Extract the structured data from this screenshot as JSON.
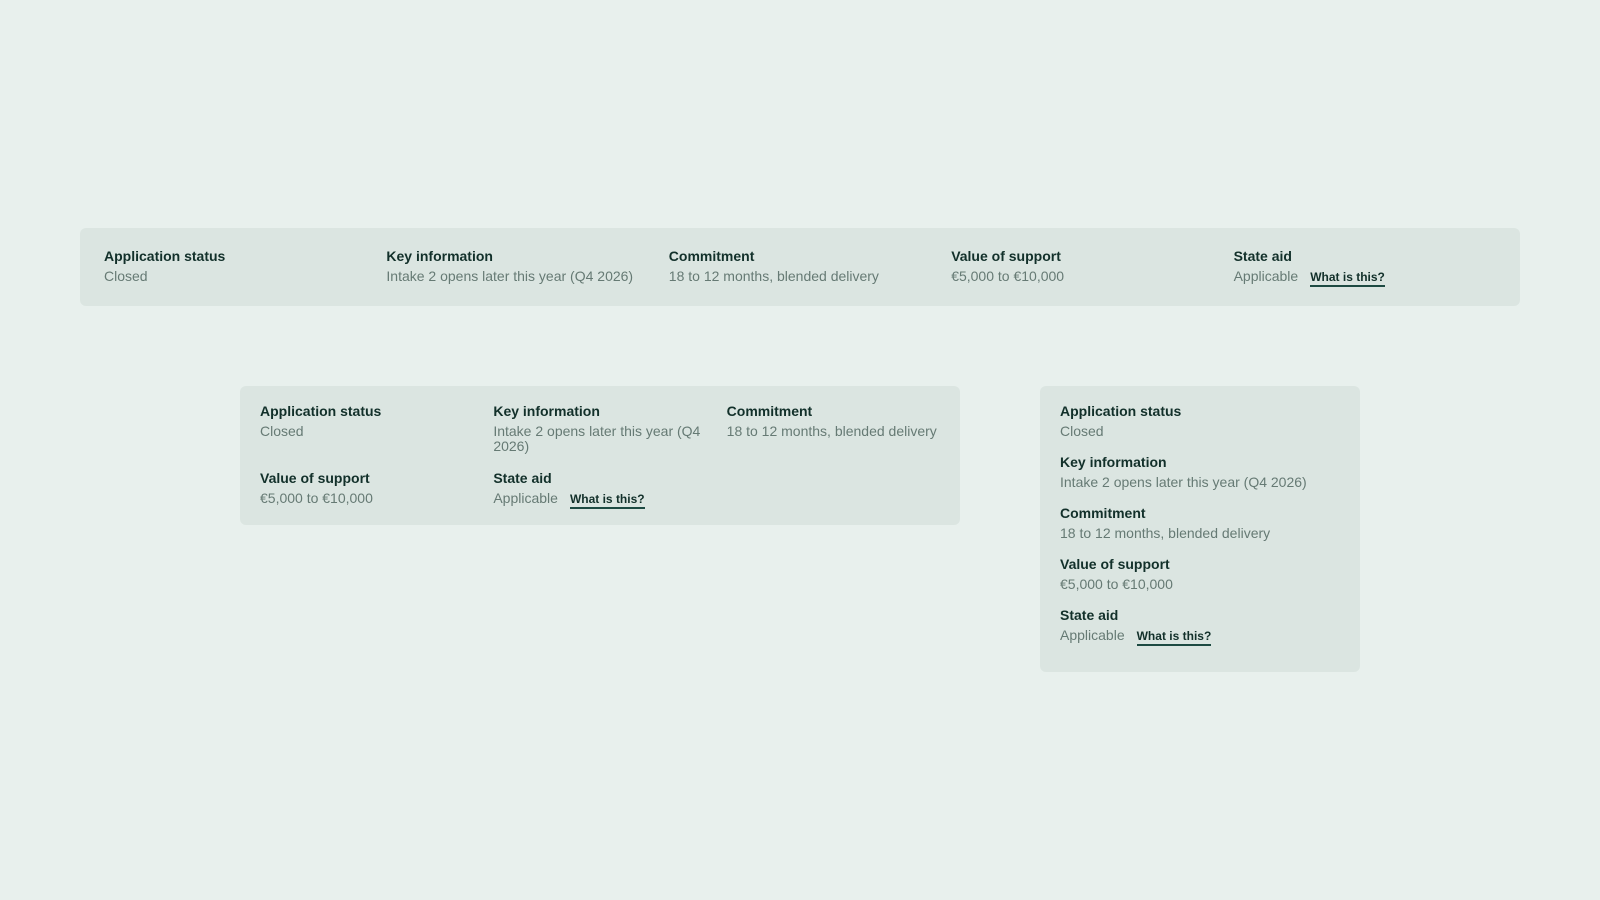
{
  "colors": {
    "background": "#e8f0ed",
    "panel": "#dbe5e1",
    "label_text": "#12302a",
    "value_text": "#667a74",
    "link_underline": "#1d4a42"
  },
  "panels": {
    "wide": {
      "application_status": {
        "label": "Application status",
        "value": "Closed"
      },
      "key_information": {
        "label": "Key information",
        "value": "Intake 2 opens later this year (Q4 2026)"
      },
      "commitment": {
        "label": "Commitment",
        "value": "18 to 12 months, blended delivery"
      },
      "value_of_support": {
        "label": "Value of support",
        "value": "€5,000 to €10,000"
      },
      "state_aid": {
        "label": "State aid",
        "value": "Applicable",
        "link": "What is this?"
      }
    },
    "medium": {
      "application_status": {
        "label": "Application status",
        "value": "Closed"
      },
      "key_information": {
        "label": "Key information",
        "value": "Intake 2 opens later this year (Q4 2026)"
      },
      "commitment": {
        "label": "Commitment",
        "value": "18 to 12 months, blended delivery"
      },
      "value_of_support": {
        "label": "Value of support",
        "value": "€5,000 to €10,000"
      },
      "state_aid": {
        "label": "State aid",
        "value": "Applicable",
        "link": "What is this?"
      }
    },
    "narrow": {
      "application_status": {
        "label": "Application status",
        "value": "Closed"
      },
      "key_information": {
        "label": "Key information",
        "value": "Intake 2 opens later this year (Q4 2026)"
      },
      "commitment": {
        "label": "Commitment",
        "value": "18 to 12 months, blended delivery"
      },
      "value_of_support": {
        "label": "Value of support",
        "value": "€5,000 to €10,000"
      },
      "state_aid": {
        "label": "State aid",
        "value": "Applicable",
        "link": "What is this?"
      }
    }
  }
}
